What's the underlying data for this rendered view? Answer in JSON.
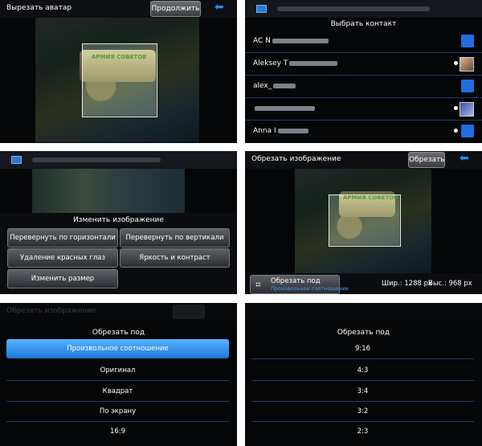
{
  "panel1": {
    "title": "Вырезать аватар",
    "continue_label": "Продолжить",
    "back_icon": "back-arrow-icon",
    "tank_text": "АРМИЯ СОВЕТОВ"
  },
  "panel2": {
    "header": "Выбрать контакт",
    "contacts": [
      {
        "name": "AC N",
        "avatar": "generic"
      },
      {
        "name": "Aleksey T",
        "avatar": "photo"
      },
      {
        "name": "alex_",
        "avatar": "generic"
      },
      {
        "name": "",
        "avatar": "photo2"
      },
      {
        "name": "Anna I",
        "avatar": "generic"
      }
    ]
  },
  "panel3": {
    "header": "Изменить изображение",
    "buttons": [
      "Перевернуть по горизонтали",
      "Перевернуть по вертикали",
      "Удаление красных глаз",
      "Яркость и контраст",
      "Изменить размер"
    ]
  },
  "panel4": {
    "title": "Обрезать изображение",
    "crop_label": "Обрезать",
    "back_icon": "back-arrow-icon",
    "crop_under_label": "Обрезать под",
    "crop_under_value": "Произвольное соотношение",
    "width_text": "Шир.: 1288 px",
    "height_text": "Выс.: 968 px"
  },
  "panel5": {
    "ghost_title": "Обрезать изображение",
    "header": "Обрезать под",
    "options": [
      "Произвольное соотношение",
      "Оригинал",
      "Квадрат",
      "По экрану",
      "16:9"
    ],
    "selected_index": 0
  },
  "panel6": {
    "header": "Обрезать под",
    "options": [
      "9:16",
      "4:3",
      "3:4",
      "3:2",
      "2:3"
    ]
  },
  "colors": {
    "accent": "#2f8be8",
    "selected": "#1b78d6",
    "divider": "#1e3b66"
  }
}
